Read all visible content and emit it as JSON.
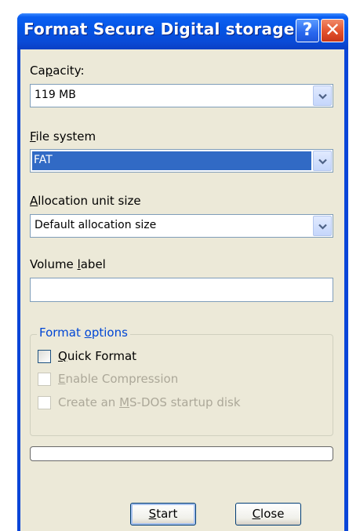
{
  "window": {
    "title": "Format Secure Digital storage...",
    "help_glyph": "?",
    "close_glyph": "✕"
  },
  "capacity": {
    "label_pre": "Ca",
    "label_key": "p",
    "label_post": "acity:",
    "value": "119 MB"
  },
  "file_system": {
    "label_pre": "",
    "label_key": "F",
    "label_post": "ile system",
    "value": "FAT"
  },
  "allocation": {
    "label_pre": "",
    "label_key": "A",
    "label_post": "llocation unit size",
    "value": "Default allocation size"
  },
  "volume": {
    "label_pre": "Volume ",
    "label_key": "l",
    "label_post": "abel",
    "value": ""
  },
  "format_options": {
    "legend_pre": "Format ",
    "legend_key": "o",
    "legend_post": "ptions",
    "quick_format": {
      "pre": "",
      "key": "Q",
      "post": "uick Format",
      "checked": false,
      "enabled": true
    },
    "enable_compression": {
      "pre": "",
      "key": "E",
      "post": "nable Compression",
      "checked": false,
      "enabled": false
    },
    "msdos_startup": {
      "pre": "Create an ",
      "key": "M",
      "post": "S-DOS startup disk",
      "checked": false,
      "enabled": false
    }
  },
  "progress": {
    "value": 0
  },
  "buttons": {
    "start": {
      "pre": "",
      "key": "S",
      "post": "tart"
    },
    "close": {
      "pre": "",
      "key": "C",
      "post": "lose"
    }
  },
  "colors": {
    "title_blue": "#0a45d8",
    "dialog_bg": "#ece9d8",
    "selection": "#316ac5",
    "group_legend": "#0046d5"
  }
}
